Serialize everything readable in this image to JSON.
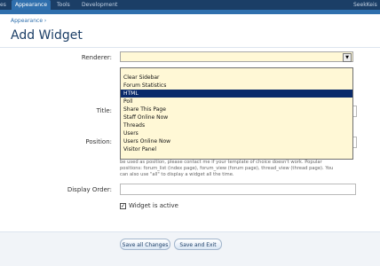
{
  "nav": {
    "tab_prev": "es",
    "tab_appearance": "Appearance",
    "tab_tools": "Tools",
    "tab_development": "Development",
    "user": "SeekKeis"
  },
  "breadcrumb": "Appearance ›",
  "page_title": "Add Widget",
  "form": {
    "renderer_label": "Renderer:",
    "title_label": "Title:",
    "position_label": "Position:",
    "display_order_label": "Display Order:",
    "widget_active_label": "Widget is active",
    "widget_active_checked": true,
    "position_explain": [
      "be used as position, please contact me if your template of choice doesn't work. Popular",
      "positions: forum_list (index page), forum_view (forum page), thread_view (thread page). You",
      "can also use \"all\" to display a widget all the time."
    ]
  },
  "renderer_options": [
    "Clear Sidebar",
    "Forum Statistics",
    "HTML",
    "Poll",
    "Share This Page",
    "Staff Online Now",
    "Threads",
    "Users",
    "Users Online Now",
    "Visitor Panel"
  ],
  "renderer_selected_index": 2,
  "buttons": {
    "save_all": "Save all Changes",
    "save_exit": "Save and Exit"
  },
  "colors": {
    "nav_bg": "#1b3e66",
    "accent": "#2f6fad",
    "select_bg": "#fff8d6",
    "highlight": "#0a2a6a"
  }
}
